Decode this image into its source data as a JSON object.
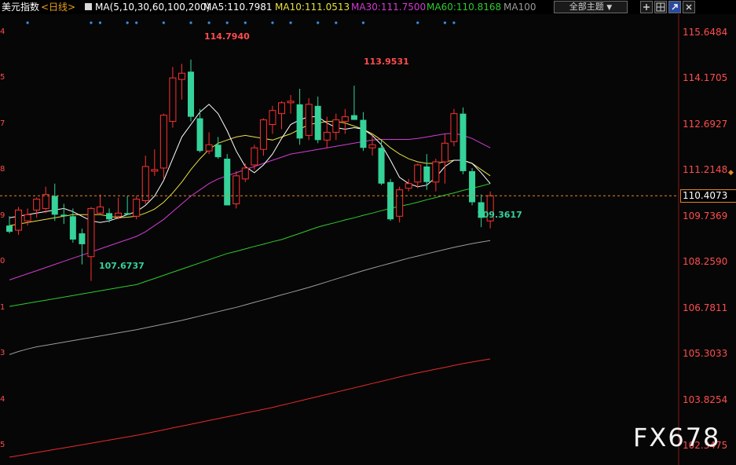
{
  "header": {
    "symbol": "美元指数",
    "period": "<日线>",
    "ma_params": "MA(5,10,30,60,100,200)",
    "ma5": "MA5:110.7981",
    "ma10": "MA10:111.0513",
    "ma30": "MA30:111.7500",
    "ma60": "MA60:110.8168",
    "ma100": "MA100",
    "theme_label": "全部主题",
    "theme_arrow": "▼"
  },
  "colors": {
    "up": "#ff3030",
    "down": "#35d29a",
    "ma5": "#ffffff",
    "ma10": "#e8e040",
    "ma30": "#d23cd2",
    "ma60": "#2ecc2e",
    "ma100": "#9a9a9a",
    "ma200": "#e82a2a",
    "axis_text": "#ff4d4d",
    "last_price_line": "#e0862a"
  },
  "axis": {
    "ticks": [
      "115.6484",
      "114.1705",
      "112.6927",
      "111.2148",
      "109.7369",
      "108.2590",
      "106.7811",
      "105.3033",
      "103.8254",
      "102.3475"
    ],
    "left_ticks": [
      "4",
      "5",
      "7",
      "8",
      "9",
      "0",
      "1",
      "3",
      "4",
      "5"
    ],
    "last_price": "110.4073"
  },
  "annotations": {
    "high1": "114.7940",
    "high2": "113.9531",
    "low1": "107.6737",
    "low2": "109.3617"
  },
  "watermark": "FX678",
  "chart_data": {
    "type": "candlestick",
    "ylim": [
      101.9,
      116.2
    ],
    "candles": [
      [
        109.45,
        109.75,
        109.2,
        109.25
      ],
      [
        109.3,
        110.05,
        109.15,
        109.95
      ],
      [
        109.6,
        110.0,
        109.45,
        109.8
      ],
      [
        109.95,
        110.35,
        109.7,
        110.3
      ],
      [
        110.0,
        110.7,
        109.85,
        110.45
      ],
      [
        110.4,
        110.8,
        109.6,
        109.8
      ],
      [
        109.8,
        110.15,
        109.5,
        109.75
      ],
      [
        109.75,
        110.0,
        108.9,
        109.0
      ],
      [
        109.2,
        109.35,
        108.2,
        108.85
      ],
      [
        108.45,
        110.05,
        107.67,
        110.0
      ],
      [
        109.85,
        110.45,
        109.8,
        110.05
      ],
      [
        109.85,
        110.0,
        109.55,
        109.65
      ],
      [
        109.75,
        110.35,
        109.65,
        109.85
      ],
      [
        109.85,
        110.4,
        109.8,
        109.8
      ],
      [
        109.75,
        110.4,
        109.65,
        110.3
      ],
      [
        110.25,
        111.7,
        110.15,
        111.35
      ],
      [
        111.2,
        111.9,
        111.05,
        111.25
      ],
      [
        111.3,
        113.05,
        110.95,
        113.0
      ],
      [
        112.8,
        114.55,
        112.6,
        114.2
      ],
      [
        114.15,
        114.65,
        113.5,
        114.35
      ],
      [
        114.4,
        114.79,
        112.8,
        112.95
      ],
      [
        112.9,
        113.2,
        111.8,
        111.85
      ],
      [
        111.85,
        112.45,
        111.75,
        112.05
      ],
      [
        112.05,
        112.3,
        111.6,
        111.65
      ],
      [
        111.6,
        111.75,
        110.15,
        110.1
      ],
      [
        110.15,
        111.2,
        110.0,
        111.05
      ],
      [
        110.95,
        111.45,
        110.85,
        111.3
      ],
      [
        111.4,
        112.05,
        111.25,
        111.95
      ],
      [
        111.9,
        112.9,
        111.7,
        112.85
      ],
      [
        112.7,
        113.3,
        112.4,
        113.15
      ],
      [
        113.05,
        113.45,
        112.55,
        113.4
      ],
      [
        113.4,
        113.65,
        113.05,
        113.45
      ],
      [
        113.35,
        113.85,
        112.05,
        112.25
      ],
      [
        112.35,
        113.55,
        112.2,
        113.35
      ],
      [
        113.3,
        113.6,
        112.1,
        112.2
      ],
      [
        112.2,
        112.95,
        111.95,
        112.45
      ],
      [
        112.45,
        113.05,
        112.2,
        112.85
      ],
      [
        112.8,
        113.2,
        112.4,
        112.95
      ],
      [
        113.0,
        113.95,
        112.85,
        112.85
      ],
      [
        112.85,
        113.1,
        111.85,
        111.95
      ],
      [
        111.95,
        112.35,
        111.7,
        112.05
      ],
      [
        111.95,
        112.2,
        110.75,
        110.8
      ],
      [
        110.85,
        110.95,
        109.6,
        109.65
      ],
      [
        109.75,
        110.7,
        109.55,
        110.6
      ],
      [
        110.65,
        110.95,
        110.55,
        110.8
      ],
      [
        110.85,
        111.45,
        110.65,
        111.4
      ],
      [
        111.35,
        111.75,
        110.6,
        110.85
      ],
      [
        110.85,
        111.6,
        110.55,
        111.5
      ],
      [
        111.5,
        112.4,
        110.8,
        112.1
      ],
      [
        112.15,
        113.2,
        112.0,
        113.05
      ],
      [
        113.05,
        113.25,
        111.1,
        111.2
      ],
      [
        111.2,
        111.3,
        110.1,
        110.2
      ],
      [
        110.2,
        110.45,
        109.4,
        109.7
      ],
      [
        109.6,
        110.55,
        109.36,
        110.41
      ]
    ],
    "ma5": [
      109.7,
      109.75,
      109.8,
      109.85,
      109.9,
      109.95,
      110.0,
      109.9,
      109.75,
      109.6,
      109.55,
      109.6,
      109.7,
      109.8,
      109.9,
      110.1,
      110.4,
      110.9,
      111.6,
      112.3,
      112.7,
      113.1,
      113.35,
      113.05,
      112.5,
      111.85,
      111.35,
      111.15,
      111.4,
      111.75,
      112.25,
      112.7,
      112.85,
      112.95,
      112.95,
      112.75,
      112.6,
      112.55,
      112.6,
      112.55,
      112.35,
      112.05,
      111.55,
      111.0,
      110.8,
      110.7,
      110.75,
      111.0,
      111.35,
      111.55,
      111.55,
      111.45,
      111.15,
      110.8
    ],
    "ma10": [
      109.45,
      109.5,
      109.55,
      109.6,
      109.65,
      109.7,
      109.75,
      109.8,
      109.8,
      109.8,
      109.8,
      109.75,
      109.7,
      109.72,
      109.75,
      109.85,
      109.98,
      110.2,
      110.5,
      110.85,
      111.25,
      111.6,
      111.9,
      112.1,
      112.2,
      112.3,
      112.35,
      112.3,
      112.25,
      112.2,
      112.3,
      112.4,
      112.55,
      112.7,
      112.75,
      112.8,
      112.8,
      112.75,
      112.65,
      112.55,
      112.4,
      112.2,
      111.95,
      111.75,
      111.6,
      111.5,
      111.45,
      111.45,
      111.5,
      111.55,
      111.55,
      111.45,
      111.25,
      111.05
    ],
    "ma30": [
      107.7,
      107.8,
      107.9,
      108.0,
      108.1,
      108.2,
      108.3,
      108.4,
      108.5,
      108.6,
      108.7,
      108.8,
      108.9,
      109.0,
      109.1,
      109.25,
      109.45,
      109.65,
      109.9,
      110.15,
      110.4,
      110.6,
      110.8,
      110.95,
      111.05,
      111.15,
      111.25,
      111.35,
      111.45,
      111.55,
      111.65,
      111.75,
      111.8,
      111.85,
      111.9,
      111.95,
      112.0,
      112.05,
      112.1,
      112.15,
      112.2,
      112.22,
      112.22,
      112.22,
      112.22,
      112.25,
      112.3,
      112.35,
      112.4,
      112.42,
      112.35,
      112.25,
      112.1,
      111.95
    ],
    "ma60": [
      106.85,
      106.9,
      106.95,
      107.0,
      107.05,
      107.1,
      107.15,
      107.2,
      107.25,
      107.3,
      107.35,
      107.4,
      107.45,
      107.5,
      107.55,
      107.65,
      107.75,
      107.85,
      107.95,
      108.05,
      108.15,
      108.25,
      108.35,
      108.45,
      108.55,
      108.62,
      108.7,
      108.78,
      108.85,
      108.93,
      109.0,
      109.1,
      109.2,
      109.3,
      109.4,
      109.48,
      109.55,
      109.63,
      109.7,
      109.78,
      109.85,
      109.93,
      110.0,
      110.07,
      110.13,
      110.2,
      110.28,
      110.35,
      110.43,
      110.5,
      110.58,
      110.65,
      110.72,
      110.8
    ],
    "ma100": [
      105.3,
      105.4,
      105.48,
      105.55,
      105.6,
      105.65,
      105.7,
      105.75,
      105.8,
      105.85,
      105.9,
      105.95,
      106.0,
      106.05,
      106.1,
      106.16,
      106.22,
      106.28,
      106.34,
      106.4,
      106.47,
      106.54,
      106.61,
      106.68,
      106.75,
      106.82,
      106.9,
      106.98,
      107.06,
      107.14,
      107.22,
      107.3,
      107.38,
      107.46,
      107.55,
      107.64,
      107.73,
      107.82,
      107.91,
      108.0,
      108.08,
      108.16,
      108.24,
      108.32,
      108.4,
      108.47,
      108.54,
      108.61,
      108.68,
      108.75,
      108.81,
      108.87,
      108.92,
      108.97
    ],
    "ma200": [
      102.0,
      102.05,
      102.1,
      102.15,
      102.2,
      102.25,
      102.3,
      102.35,
      102.4,
      102.45,
      102.5,
      102.55,
      102.6,
      102.65,
      102.7,
      102.76,
      102.82,
      102.88,
      102.94,
      103.0,
      103.06,
      103.12,
      103.18,
      103.24,
      103.3,
      103.36,
      103.42,
      103.48,
      103.54,
      103.6,
      103.67,
      103.74,
      103.81,
      103.88,
      103.95,
      104.02,
      104.09,
      104.16,
      104.23,
      104.3,
      104.37,
      104.44,
      104.51,
      104.58,
      104.65,
      104.71,
      104.77,
      104.83,
      104.89,
      104.95,
      105.01,
      105.06,
      105.11,
      105.16
    ]
  }
}
